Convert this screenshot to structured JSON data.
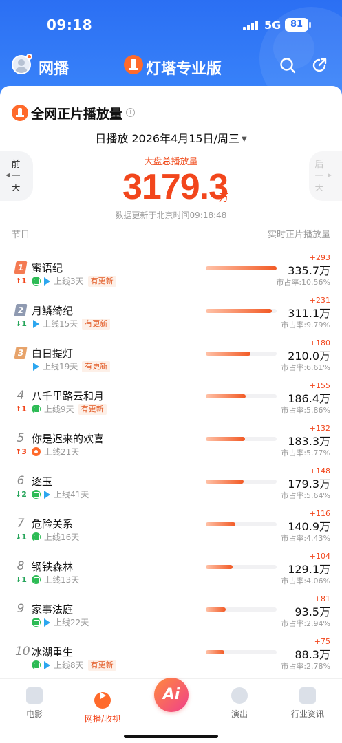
{
  "status_bar": {
    "time": "09:18",
    "network": "5G",
    "battery": "81"
  },
  "app_bar": {
    "tab": "网播",
    "brand": "灯塔专业版"
  },
  "section": {
    "title": "全网正片播放量",
    "date_label": "日播放 2026年4月15日/周三",
    "prev_label": "前一天",
    "next_label": "后一天"
  },
  "total": {
    "label": "大盘总播放量",
    "value": "3179.3",
    "unit": "万",
    "update_text": "数据更新于北京时间09:18:48"
  },
  "columns": {
    "left": "节目",
    "right": "实时正片播放量"
  },
  "share_prefix": "市占率:",
  "rows": [
    {
      "rank": "1",
      "trend": "↑1",
      "trend_dir": "up",
      "name": "蜜语纪",
      "platforms": [
        "iqiyi",
        "tencent"
      ],
      "online": "上线3天",
      "tag": "有更新",
      "delta": "+293",
      "value": "335.7万",
      "share": "10.56%",
      "bar": 1.0
    },
    {
      "rank": "2",
      "trend": "↓1",
      "trend_dir": "down",
      "name": "月鳞绮纪",
      "platforms": [
        "tencent"
      ],
      "online": "上线15天",
      "tag": "有更新",
      "delta": "+231",
      "value": "311.1万",
      "share": "9.79%",
      "bar": 0.93
    },
    {
      "rank": "3",
      "trend": "",
      "trend_dir": "",
      "name": "白日提灯",
      "platforms": [
        "tencent"
      ],
      "online": "上线19天",
      "tag": "有更新",
      "delta": "+180",
      "value": "210.0万",
      "share": "6.61%",
      "bar": 0.63
    },
    {
      "rank": "4",
      "trend": "↑1",
      "trend_dir": "up",
      "name": "八千里路云和月",
      "platforms": [
        "iqiyi"
      ],
      "online": "上线9天",
      "tag": "有更新",
      "delta": "+155",
      "value": "186.4万",
      "share": "5.86%",
      "bar": 0.56
    },
    {
      "rank": "5",
      "trend": "↑3",
      "trend_dir": "up",
      "name": "你是迟来的欢喜",
      "platforms": [
        "youku"
      ],
      "online": "上线21天",
      "tag": "",
      "delta": "+132",
      "value": "183.3万",
      "share": "5.77%",
      "bar": 0.55
    },
    {
      "rank": "6",
      "trend": "↓2",
      "trend_dir": "down",
      "name": "逐玉",
      "platforms": [
        "iqiyi",
        "tencent"
      ],
      "online": "上线41天",
      "tag": "",
      "delta": "+148",
      "value": "179.3万",
      "share": "5.64%",
      "bar": 0.53
    },
    {
      "rank": "7",
      "trend": "↓1",
      "trend_dir": "down",
      "name": "危险关系",
      "platforms": [
        "iqiyi"
      ],
      "online": "上线16天",
      "tag": "",
      "delta": "+116",
      "value": "140.9万",
      "share": "4.43%",
      "bar": 0.42
    },
    {
      "rank": "8",
      "trend": "↓1",
      "trend_dir": "down",
      "name": "钢铁森林",
      "platforms": [
        "iqiyi"
      ],
      "online": "上线13天",
      "tag": "",
      "delta": "+104",
      "value": "129.1万",
      "share": "4.06%",
      "bar": 0.38
    },
    {
      "rank": "9",
      "trend": "",
      "trend_dir": "",
      "name": "家事法庭",
      "platforms": [
        "iqiyi",
        "tencent"
      ],
      "online": "上线22天",
      "tag": "",
      "delta": "+81",
      "value": "93.5万",
      "share": "2.94%",
      "bar": 0.28
    },
    {
      "rank": "10",
      "trend": "",
      "trend_dir": "",
      "name": "冰湖重生",
      "platforms": [
        "iqiyi",
        "tencent"
      ],
      "online": "上线8天",
      "tag": "有更新",
      "delta": "+75",
      "value": "88.3万",
      "share": "2.78%",
      "bar": 0.26
    }
  ],
  "tabbar": {
    "movie": "电影",
    "web": "网播/收视",
    "ai": "Ai",
    "show": "演出",
    "news": "行业资讯"
  },
  "colors": {
    "accent": "#f2461c",
    "brand_blue": "#2b6ff3",
    "up": "#f2461c",
    "down": "#27a55b",
    "tag_bg": "#fdf0e8"
  }
}
